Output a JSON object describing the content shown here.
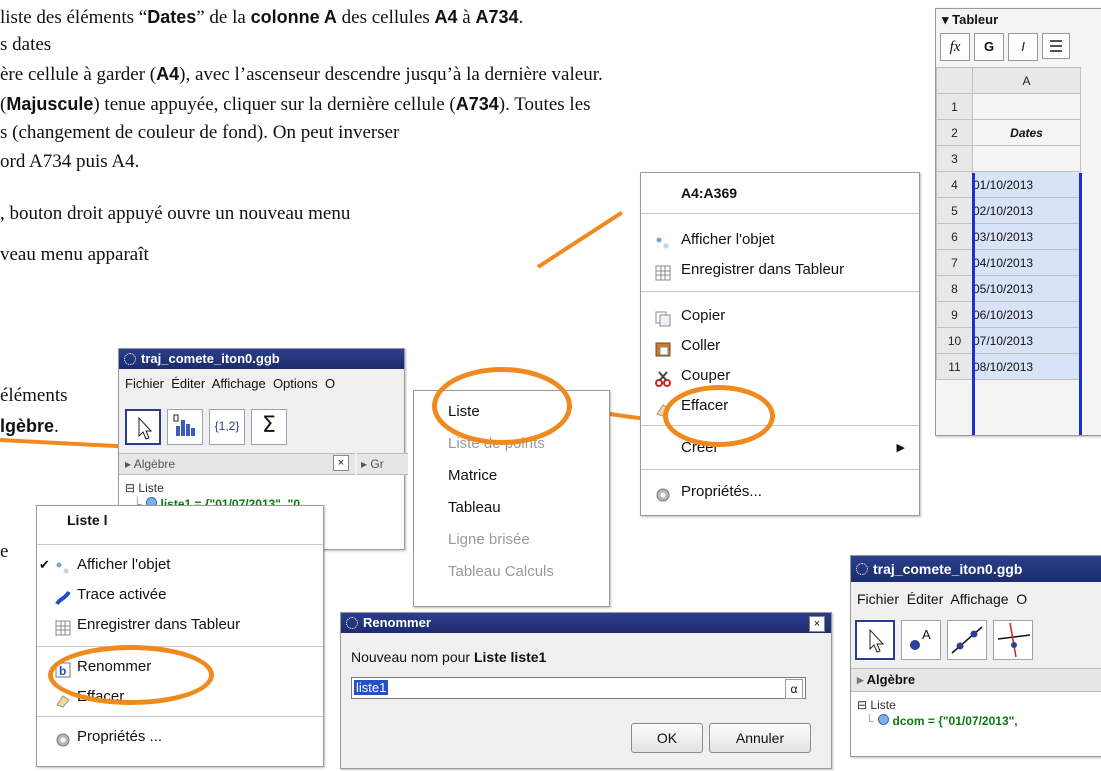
{
  "doc": {
    "line1": {
      "pre": "liste des éléments “",
      "dates": "Dates",
      "mid": "” de la ",
      "colA": "colonne A",
      "mid2": " des cellules ",
      "a4": "A4",
      "a": " à ",
      "a734": "A734",
      "end": "."
    },
    "line2": "s dates",
    "line3": {
      "pre": "ère cellule à garder (",
      "a4": "A4",
      "end": "), avec l’ascenseur descendre jusqu’à la dernière valeur."
    },
    "line4": {
      "pre": "(",
      "maj": "Majuscule",
      "mid": ") tenue appuyée, cliquer sur la dernière cellule (",
      "a734": "A734",
      "end": "). Toutes les"
    },
    "line5": "s (changement de couleur de fond). On peut inverser",
    "line6": "ord A734 puis A4.",
    "line7": ", bouton droit appuyé ouvre un nouveau menu",
    "line8": "veau menu apparaît",
    "line9": "éléments",
    "line10": {
      "b": "lgèbre",
      "end": "."
    },
    "line11": "e"
  },
  "spreadsheet": {
    "title": "Tableur",
    "toolbar": [
      "fx",
      "G",
      "I"
    ],
    "col_header": "A",
    "rows": [
      {
        "n": "1",
        "v": ""
      },
      {
        "n": "2",
        "v": "Dates"
      },
      {
        "n": "3",
        "v": ""
      },
      {
        "n": "4",
        "v": "01/10/2013"
      },
      {
        "n": "5",
        "v": "02/10/2013"
      },
      {
        "n": "6",
        "v": "03/10/2013"
      },
      {
        "n": "7",
        "v": "04/10/2013"
      },
      {
        "n": "8",
        "v": "05/10/2013"
      },
      {
        "n": "9",
        "v": "06/10/2013"
      },
      {
        "n": "10",
        "v": "07/10/2013"
      },
      {
        "n": "11",
        "v": "08/10/2013"
      }
    ]
  },
  "context_menu": {
    "title": "A4:A369",
    "items": [
      "Afficher l'objet",
      "Enregistrer dans Tableur",
      "Copier",
      "Coller",
      "Couper",
      "Effacer",
      "Créer",
      "Propriétés..."
    ]
  },
  "create_submenu": {
    "items": [
      "Liste",
      "Liste de points",
      "Matrice",
      "Tableau",
      "Ligne brisée",
      "Tableau Calculs"
    ]
  },
  "window1": {
    "title": "traj_comete_iton0.ggb",
    "menus": [
      "Fichier",
      "Éditer",
      "Affichage",
      "Options",
      "O"
    ],
    "algebra_label": "Algèbre",
    "graph_label": "Gr",
    "close": "×",
    "tool_braces": "{1,2}",
    "tool_sigma": "Σ",
    "tree_label": "Liste",
    "item": "liste1 = {\"01/07/2013\", \"0"
  },
  "object_menu": {
    "title": "Liste l",
    "items": [
      "Afficher l'objet",
      "Trace activée",
      "Enregistrer dans Tableur",
      "Renommer",
      "Effacer",
      "Propriétés ..."
    ]
  },
  "rename_dialog": {
    "title": "Renommer",
    "close": "×",
    "prompt_pre": "Nouveau nom pour ",
    "prompt_bold": "Liste liste1",
    "value": "liste1",
    "alpha": "α",
    "ok": "OK",
    "cancel": "Annuler"
  },
  "window2": {
    "title": "traj_comete_iton0.ggb",
    "menus": [
      "Fichier",
      "Éditer",
      "Affichage",
      "O"
    ],
    "algebra_label": "Algèbre",
    "tree_label": "Liste",
    "item": "dcom = {\"01/07/2013\","
  },
  "colors": {
    "accent": "#f08a1e",
    "title_bar": "#1c2c6b",
    "formula_green": "#0a7a0a",
    "selection": "#d9e3f7"
  }
}
